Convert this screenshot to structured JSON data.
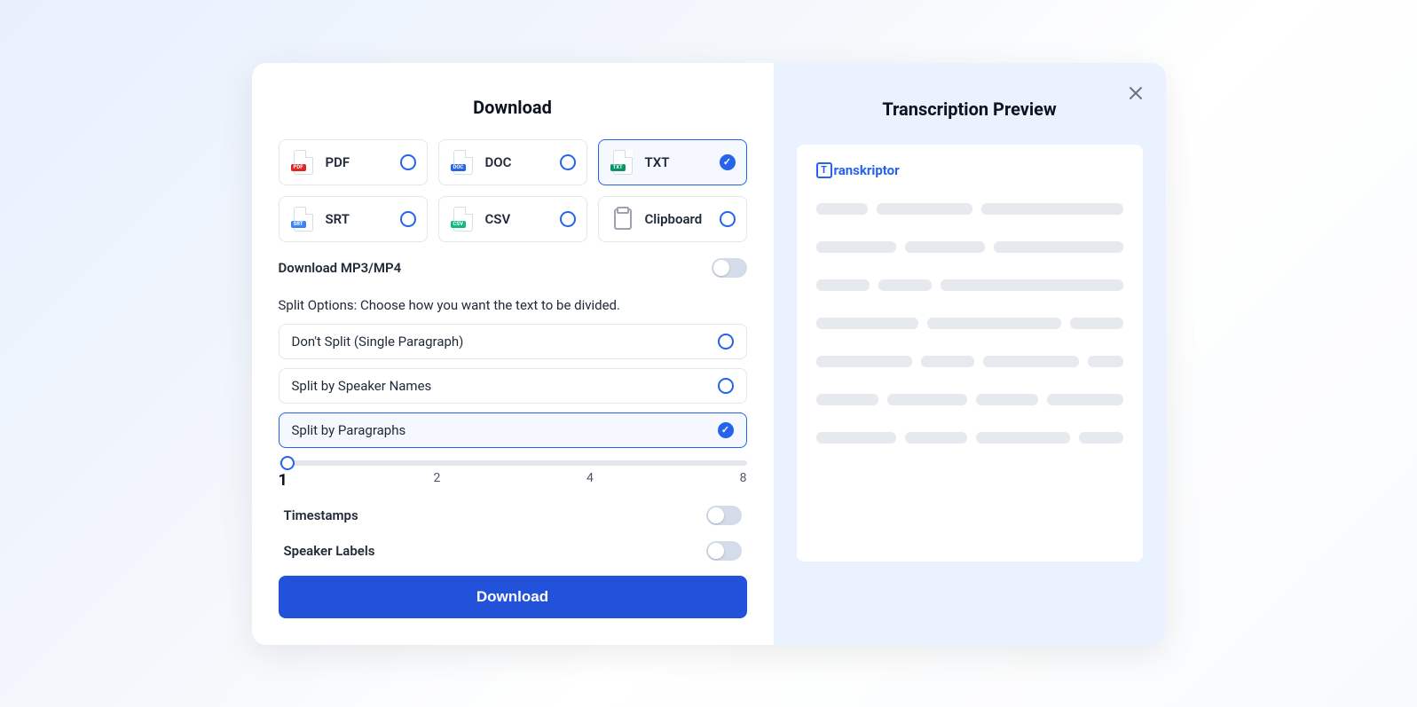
{
  "modal": {
    "title": "Download",
    "formats": [
      {
        "label": "PDF",
        "badge": "PDF",
        "selected": false
      },
      {
        "label": "DOC",
        "badge": "DOC",
        "selected": false
      },
      {
        "label": "TXT",
        "badge": "TXT",
        "selected": true
      },
      {
        "label": "SRT",
        "badge": "SRT",
        "selected": false
      },
      {
        "label": "CSV",
        "badge": "CSV",
        "selected": false
      },
      {
        "label": "Clipboard",
        "badge": "",
        "selected": false
      }
    ],
    "mp3mp4_label": "Download MP3/MP4",
    "mp3mp4_on": false,
    "split_section_label": "Split Options: Choose how you want the text to be divided.",
    "split_options": [
      {
        "label": "Don't Split (Single Paragraph)",
        "selected": false
      },
      {
        "label": "Split by Speaker Names",
        "selected": false
      },
      {
        "label": "Split by Paragraphs",
        "selected": true
      }
    ],
    "slider": {
      "value": 1,
      "ticks": [
        "1",
        "2",
        "4",
        "8"
      ]
    },
    "timestamps_label": "Timestamps",
    "timestamps_on": false,
    "speaker_labels_label": "Speaker Labels",
    "speaker_labels_on": false,
    "download_button": "Download"
  },
  "preview": {
    "title": "Transcription Preview",
    "logo_text": "ranskriptor",
    "logo_letter": "T"
  }
}
